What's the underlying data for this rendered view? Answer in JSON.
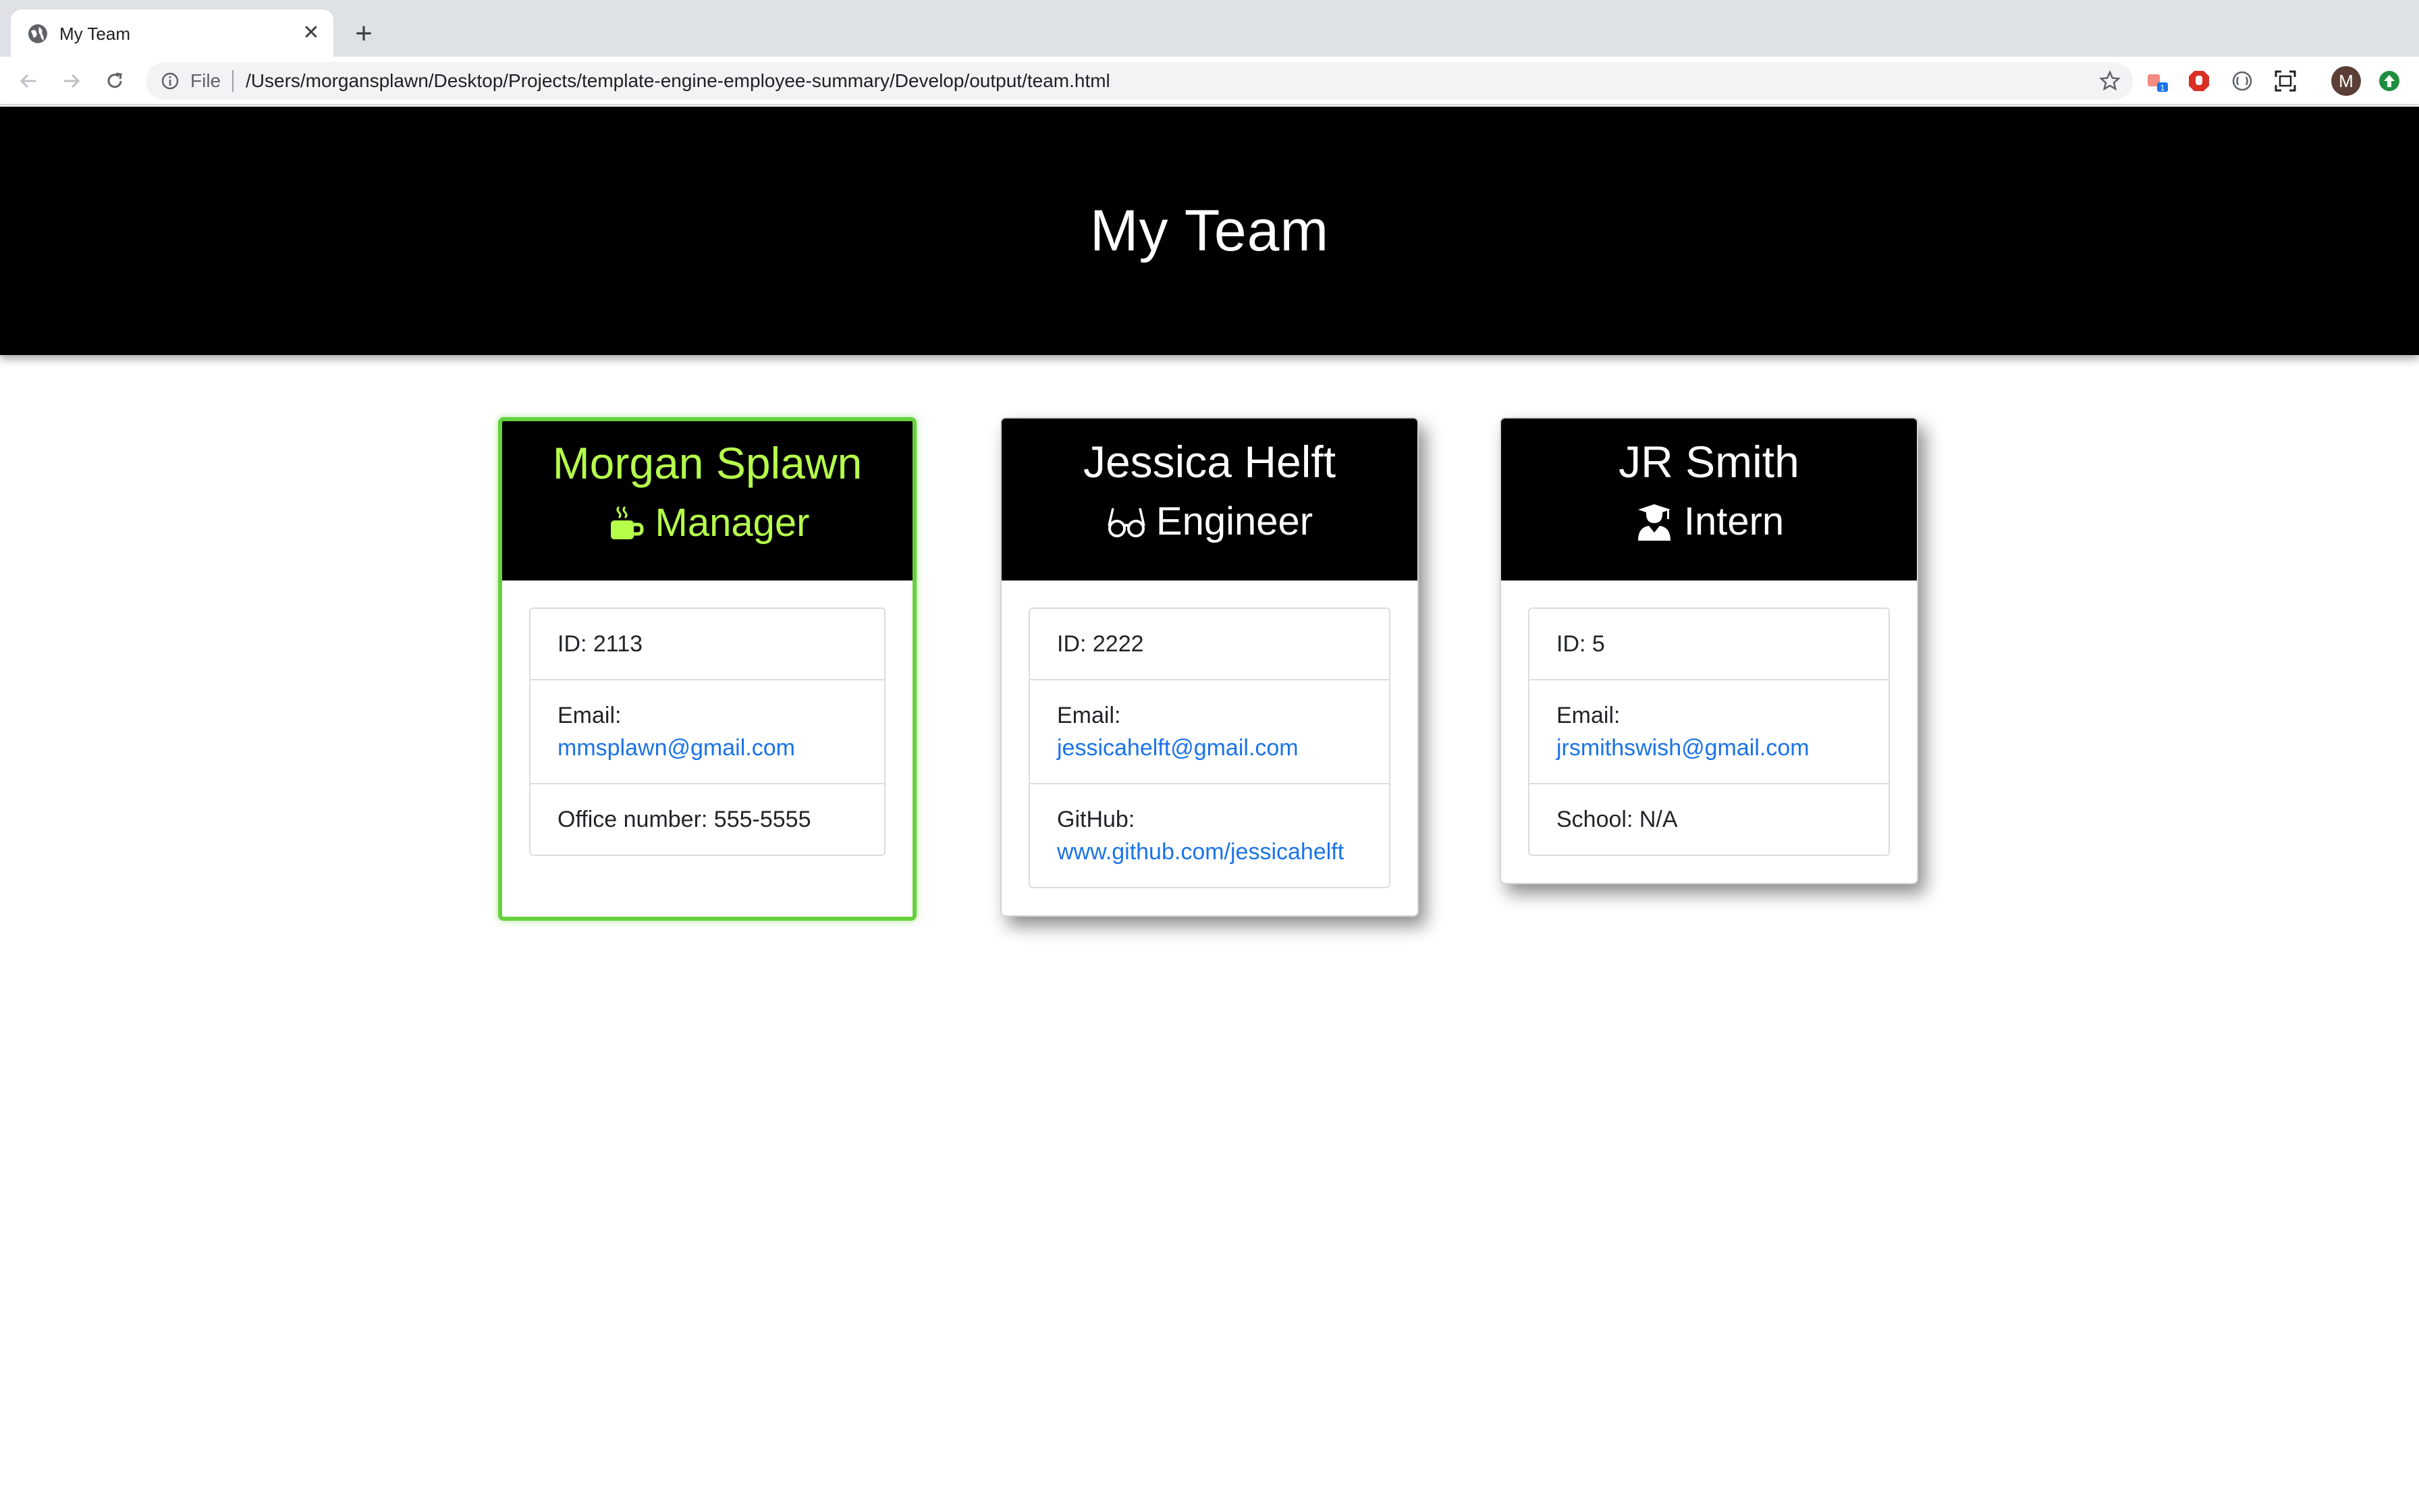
{
  "browser": {
    "tab_title": "My Team",
    "new_tab": "+",
    "scheme_label": "File",
    "url": "/Users/morgansplawn/Desktop/Projects/template-engine-employee-summary/Develop/output/team.html",
    "profile_initial": "M"
  },
  "page": {
    "heading": "My Team"
  },
  "cards": [
    {
      "name": "Morgan Splawn",
      "role": "Manager",
      "icon": "coffee-mug-icon",
      "accent_color": "#b6ff4b",
      "border_color": "#66d13c",
      "id_label": "ID: 2113",
      "email_prefix": "Email: ",
      "email": "mmsplawn@gmail.com",
      "extra_prefix": "Office number: 555-5555",
      "extra_value": ""
    },
    {
      "name": "Jessica Helft",
      "role": "Engineer",
      "icon": "glasses-icon",
      "id_label": "ID: 2222",
      "email_prefix": "Email: ",
      "email": "jessicahelft@gmail.com",
      "extra_prefix": "GitHub:",
      "extra_value": "www.github.com/jessicahelft"
    },
    {
      "name": "JR Smith",
      "role": "Intern",
      "icon": "graduate-icon",
      "id_label": "ID: 5",
      "email_prefix": "Email:",
      "email": "jrsmithswish@gmail.com",
      "extra_prefix": "School: N/A",
      "extra_value": ""
    }
  ],
  "colors": {
    "header_bg": "#000000",
    "link": "#1a73e8"
  }
}
